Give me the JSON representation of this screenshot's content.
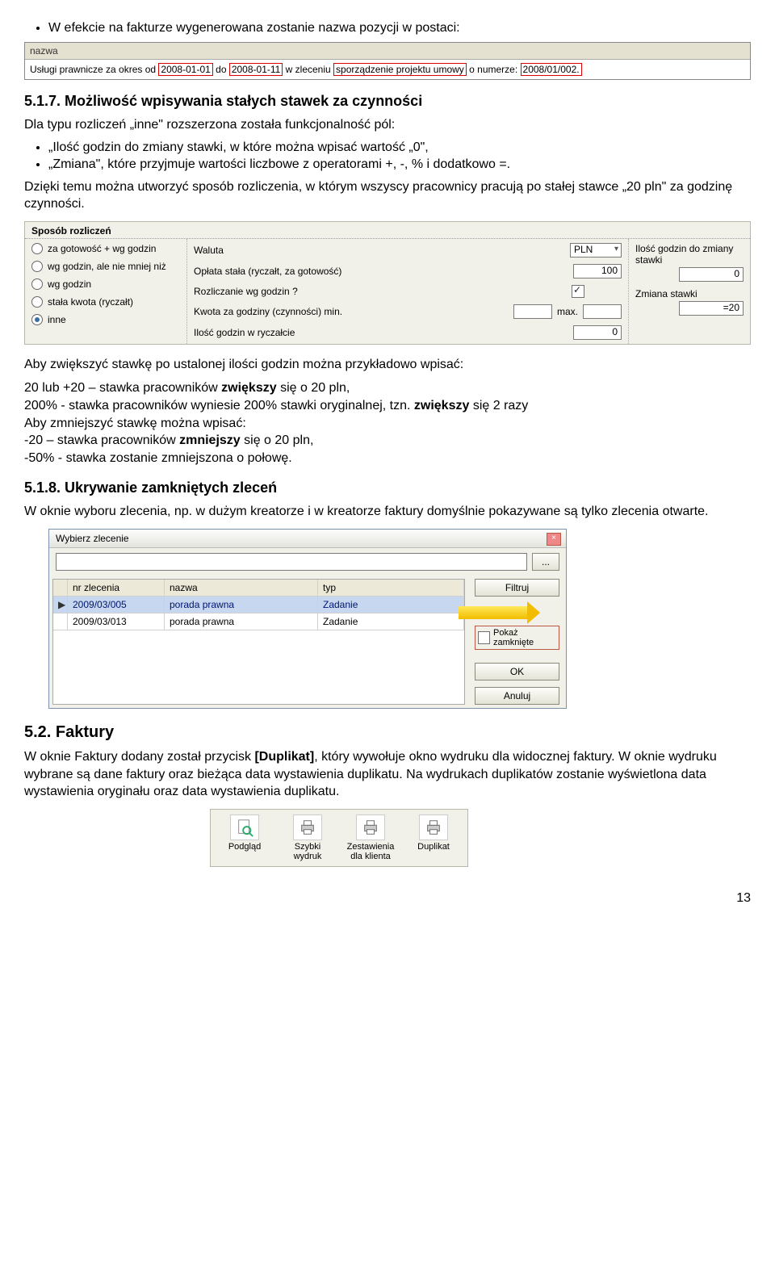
{
  "intro_bullet": "W efekcie na fakturze wygenerowana zostanie nazwa pozycji w postaci:",
  "invoice": {
    "header": "nazwa",
    "prefix": "Usługi prawnicze za okres od ",
    "d1": "2008-01-01",
    "mid1": " do ",
    "d2": "2008-01-11",
    "mid2": " w zleceniu ",
    "p1": "sporządzenie projektu umowy",
    "mid3": " o numerze: ",
    "num": "2008/01/002."
  },
  "sec517": {
    "heading": "5.1.7. Możliwość wpisywania stałych stawek za czynności",
    "p1": "Dla typu rozliczeń „inne\" rozszerzona została funkcjonalność pól:",
    "b1": "„Ilość godzin do zmiany stawki, w które można wpisać wartość „0\",",
    "b2": "„Zmiana\", które przyjmuje wartości liczbowe z operatorami +, -, % i dodatkowo =.",
    "p2": "Dzięki temu można utworzyć sposób rozliczenia, w którym wszyscy pracownicy pracują po stałej stawce „20 pln\" za godzinę czynności."
  },
  "panel": {
    "group_title": "Sposób rozliczeń",
    "r1": "za gotowość + wg godzin",
    "r2": "wg godzin, ale nie mniej niż",
    "r3": "wg godzin",
    "r4": "stała kwota (ryczałt)",
    "r5": "inne",
    "lbl_currency": "Waluta",
    "val_currency": "PLN",
    "lbl_flat": "Opłata stała (ryczałt, za gotowość)",
    "val_flat": "100",
    "lbl_hours_q": "Rozliczanie wg godzin ?",
    "lbl_phr": "Kwota za godziny (czynności)   min.",
    "lbl_max": "max.",
    "lbl_inc": "Ilość godzin w ryczałcie",
    "val_inc": "0",
    "lbl_hrs_change": "Ilość godzin do zmiany stawki",
    "val_hrs_change": "0",
    "lbl_change": "Zmiana stawki",
    "val_change": "=20"
  },
  "after_panel": {
    "p1": "Aby zwiększyć stawkę po ustalonej ilości godzin można przykładowo wpisać:",
    "p2a": "20 lub +20 – stawka pracowników ",
    "p2b": "zwiększy",
    "p2c": " się o 20 pln,",
    "p3a": "200% - stawka pracowników wyniesie 200% stawki oryginalnej, tzn. ",
    "p3b": "zwiększy",
    "p3c": " się 2 razy",
    "p4": "Aby zmniejszyć stawkę można wpisać:",
    "p5a": "-20 – stawka pracowników ",
    "p5b": "zmniejszy",
    "p5c": " się o 20 pln,",
    "p6": "-50% - stawka zostanie zmniejszona o połowę."
  },
  "sec518": {
    "heading": "5.1.8. Ukrywanie zamkniętych zleceń",
    "p1": "W oknie wyboru zlecenia, np. w dużym kreatorze i w kreatorze faktury domyślnie pokazywane są tylko zlecenia otwarte."
  },
  "dlg": {
    "title": "Wybierz zlecenie",
    "browse": "...",
    "col_nr": "nr zlecenia",
    "col_nm": "nazwa",
    "col_tp": "typ",
    "r1_nr": "2009/03/005",
    "r1_nm": "porada prawna",
    "r1_tp": "Zadanie",
    "r2_nr": "2009/03/013",
    "r2_nm": "porada prawna",
    "r2_tp": "Zadanie",
    "btn_filter": "Filtruj",
    "chk_closed": "Pokaż zamknięte",
    "btn_ok": "OK",
    "btn_cancel": "Anuluj"
  },
  "sec52": {
    "heading": "5.2. Faktury",
    "p1a": "W oknie Faktury dodany został przycisk ",
    "p1b": "[Duplikat]",
    "p1c": ", który wywołuje okno wydruku dla widocznej faktury. W oknie wydruku wybrane są dane faktury oraz bieżąca data wystawienia duplikatu. Na wydrukach duplikatów zostanie wyświetlona data wystawienia oryginału oraz data wystawienia duplikatu."
  },
  "toolbar": {
    "b1": "Podgląd",
    "b2": "Szybki wydruk",
    "b3": "Zestawienia dla klienta",
    "b4": "Duplikat"
  },
  "page_no": "13"
}
